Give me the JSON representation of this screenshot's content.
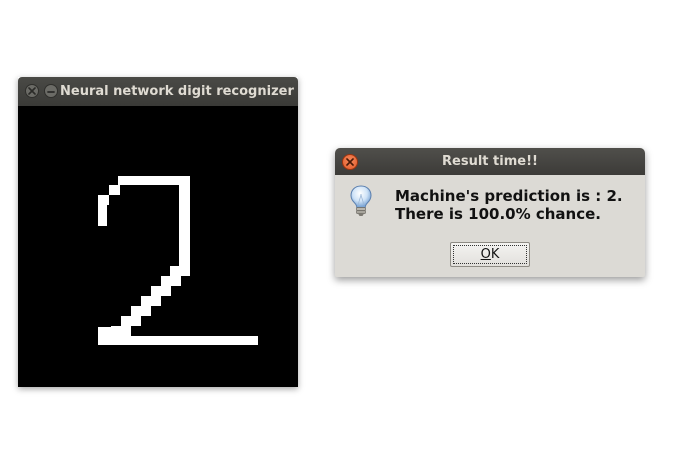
{
  "canvas_window": {
    "title": "Neural network digit recognizer",
    "close_icon": "close-icon",
    "minimize_icon": "minimize-icon",
    "drawn_digit": "2",
    "background_color": "#000000",
    "stroke_color": "#ffffff"
  },
  "dialog": {
    "title": "Result time!!",
    "icon": "lightbulb-info-icon",
    "message_line1": "Machine's prediction is : 2.",
    "message_line2": "There is 100.0% chance.",
    "ok_mnemonic": "O",
    "ok_rest": "K",
    "close_color": "#e95420"
  }
}
